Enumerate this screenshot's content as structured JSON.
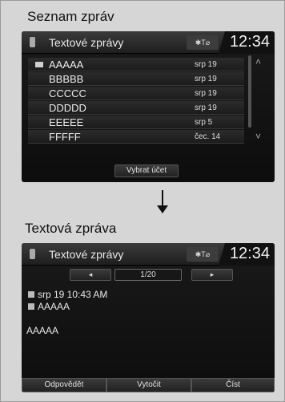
{
  "list_section": {
    "label": "Seznam zpráv",
    "title": "Textové zprávy",
    "status": "✱T⌀",
    "clock": "12:34",
    "messages": [
      {
        "name": "AAAAA",
        "date": "srp 19",
        "unread": true
      },
      {
        "name": "BBBBB",
        "date": "srp 19",
        "unread": false
      },
      {
        "name": "CCCCC",
        "date": "srp 19",
        "unread": false
      },
      {
        "name": "DDDDD",
        "date": "srp 19",
        "unread": false
      },
      {
        "name": "EEEEE",
        "date": "srp 5",
        "unread": false
      },
      {
        "name": "FFFFF",
        "date": "čec. 14",
        "unread": false
      }
    ],
    "select_account": "Vybrat účet",
    "scroll_up": "˄",
    "scroll_down": "˅"
  },
  "detail_section": {
    "label": "Textová zpráva",
    "title": "Textové zprávy",
    "status": "✱T⌀",
    "clock": "12:34",
    "prev": "◂",
    "next": "▸",
    "page": "1/20",
    "datetime": "srp 19 10:43 AM",
    "sender": "AAAAA",
    "body": "AAAAA",
    "buttons": {
      "reply": "Odpovědět",
      "call": "Vytočit",
      "read": "Číst"
    }
  },
  "colors": {
    "screen_bg": "#111111",
    "frame_bg": "#d6d6d6",
    "text": "#ececec"
  }
}
